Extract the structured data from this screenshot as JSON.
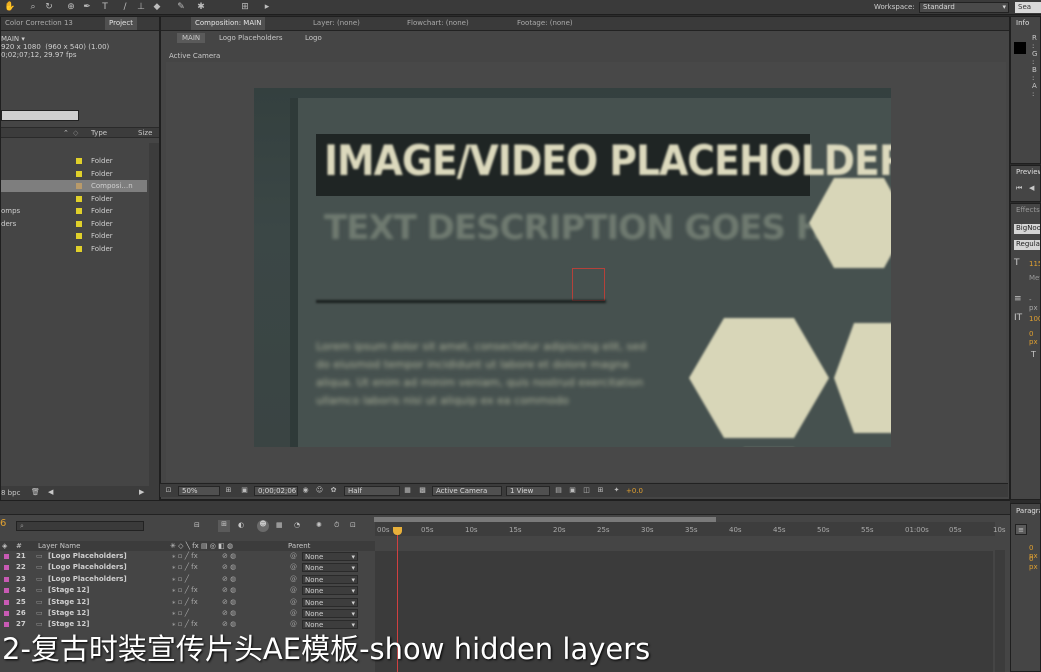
{
  "toolbar": {
    "workspace_label": "Workspace:",
    "workspace_value": "Standard",
    "search_help": "Sea"
  },
  "project_panel": {
    "tabs": [
      "Color Correction 13",
      "Project"
    ],
    "comp_name": "MAIN ▾",
    "comp_size": "920 x 1080  (960 x 540) (1.00)",
    "comp_duration": "0;02;07;12, 29.97 fps",
    "col_type": "Type",
    "col_size": "Size",
    "items": [
      {
        "name": "",
        "type": "Folder",
        "selected": false
      },
      {
        "name": "",
        "type": "Folder",
        "selected": false
      },
      {
        "name": "",
        "type": "Composi…n",
        "selected": true
      },
      {
        "name": "",
        "type": "Folder",
        "selected": false
      },
      {
        "name": "omps",
        "type": "Folder",
        "selected": false
      },
      {
        "name": "ders",
        "type": "Folder",
        "selected": false
      },
      {
        "name": "",
        "type": "Folder",
        "selected": false
      },
      {
        "name": "",
        "type": "Folder",
        "selected": false
      }
    ],
    "bpc": "8 bpc"
  },
  "composition_panel": {
    "tab_comp": "Composition: MAIN",
    "tab_layer": "Layer: (none)",
    "tab_flowchart": "Flowchart: (none)",
    "tab_footage": "Footage: (none)",
    "breadcrumbs": [
      "MAIN",
      "Logo Placeholders",
      "Logo"
    ],
    "view_label": "Active Camera",
    "viewer": {
      "title": "IMAGE/VIDEO PLACEHOLDER",
      "subtitle": "TEXT DESCRIPTION GOES HERE",
      "lorem": "Lorem ipsum dolor sit amet, consectetur adipiscing elit, sed do eiusmod tempor incididunt ut labore et dolore magna aliqua. Ut enim ad minim veniam, quis nostrud exercitation ullamco laboris nisi ut aliquip ex ea commodo"
    },
    "footer": {
      "zoom": "50%",
      "timecode": "0;00;02;06",
      "resolution": "Half",
      "camera": "Active Camera",
      "views": "1 View",
      "exposure": "+0.0"
    }
  },
  "right_panels": {
    "info_tab": "Info",
    "info_lines": [
      "R :",
      "G :",
      "B :",
      "A :"
    ],
    "preview_tab": "Preview",
    "effects_tab": "Effects",
    "char_font": "BigNoo",
    "char_style": "Regular",
    "char_size": "115",
    "char_leading": "Met",
    "char_tracking": "- px",
    "char_vscale": "100",
    "char_baseline": "0 px",
    "paragraph_tab": "Paragra",
    "para_indent1": "0 px",
    "para_indent2": "0 px"
  },
  "timeline": {
    "frames_label": "6",
    "search_placeholder": "",
    "col_num": "#",
    "col_layer_name": "Layer Name",
    "col_parent": "Parent",
    "ruler_ticks": [
      "00s",
      "05s",
      "10s",
      "15s",
      "20s",
      "25s",
      "30s",
      "35s",
      "40s",
      "45s",
      "50s",
      "55s",
      "01:00s",
      "05s",
      "10s"
    ],
    "layers": [
      {
        "num": "21",
        "name": "[Logo Placeholders]",
        "parent": "None",
        "color": "#c85ab4",
        "fx": true
      },
      {
        "num": "22",
        "name": "[Logo Placeholders]",
        "parent": "None",
        "color": "#c85ab4",
        "fx": true
      },
      {
        "num": "23",
        "name": "[Logo Placeholders]",
        "parent": "None",
        "color": "#c85ab4",
        "fx": false
      },
      {
        "num": "24",
        "name": "[Stage 12]",
        "parent": "None",
        "color": "#c85ab4",
        "fx": true
      },
      {
        "num": "25",
        "name": "[Stage 12]",
        "parent": "None",
        "color": "#c85ab4",
        "fx": true
      },
      {
        "num": "26",
        "name": "[Stage 12]",
        "parent": "None",
        "color": "#c85ab4",
        "fx": false
      },
      {
        "num": "27",
        "name": "[Stage 12]",
        "parent": "None",
        "color": "#c85ab4",
        "fx": true
      }
    ]
  },
  "caption": "2-复古时装宣传片头AE模板-show hidden layers"
}
